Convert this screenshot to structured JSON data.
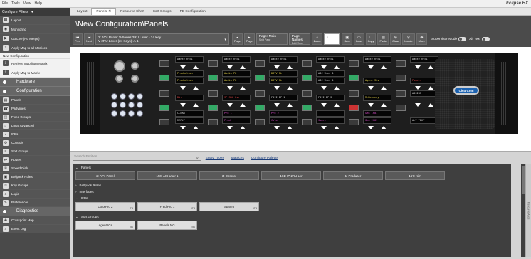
{
  "menu": {
    "items": [
      "File",
      "Tools",
      "View",
      "Help"
    ],
    "brand": "Eclipse HX"
  },
  "sidebar": {
    "header": "Configure Filters",
    "top_items": [
      {
        "label": "Layout",
        "icon": "layout-icon"
      },
      {
        "label": "Monitoring",
        "icon": "monitor-icon"
      },
      {
        "label": "Go Live (No Merge)",
        "icon": "golive-icon"
      },
      {
        "label": "Apply Map to all Matrices",
        "icon": "apply-icon"
      }
    ],
    "panel_items": [
      {
        "label": "New Configuration",
        "icon": ""
      },
      {
        "label": "Retrieve Map from Matrix",
        "icon": "retrieve-icon"
      },
      {
        "label": "Apply Map to Matrix",
        "icon": "apply-icon"
      }
    ],
    "sections": [
      {
        "label": "Hardware"
      },
      {
        "label": "Configuration"
      },
      {
        "label": "Diagnostics"
      }
    ],
    "config_items": [
      {
        "label": "Panels"
      },
      {
        "label": "Partylines"
      },
      {
        "label": "Fixed Groups"
      },
      {
        "label": "Local Advanced"
      },
      {
        "label": "IFBs"
      },
      {
        "label": "Controls"
      },
      {
        "label": "Sort Groups"
      },
      {
        "label": "Routes"
      },
      {
        "label": "Speed Dials"
      },
      {
        "label": "Bellpack Roles"
      },
      {
        "label": "Key Groups"
      },
      {
        "label": "Logic"
      },
      {
        "label": "Preferences"
      }
    ],
    "diag_items": [
      {
        "label": "Crosspoint Map"
      },
      {
        "label": "Event Log"
      }
    ]
  },
  "tabs": [
    "Layout",
    "Panels",
    "Resource Chart",
    "Sort Groups",
    "PB Configuration"
  ],
  "page": {
    "title": "\\New Configuration\\Panels",
    "toolbar": {
      "prev": "Prev",
      "next": "Next",
      "panel_line1": "2: AT's Panel: V-Series 2RU Lever - 24 Key",
      "panel_line2": "V 2RU Lever (24 Keys): A-1",
      "page_prev": "Page",
      "page_next": "Page",
      "page_select": "Page: Main",
      "page_select_sub": "Shift Page",
      "page_names": "Page Names",
      "page_names_sub": "Edit/View",
      "zoom": "Zoom",
      "save": "Save",
      "load": "Load",
      "copy": "Copy",
      "paste": "Paste",
      "clear": "Clear",
      "locate": "Locate",
      "move": "Move",
      "supervisor": "Supervisor Mode",
      "alttext": "Alt Text"
    }
  },
  "device": {
    "lcd_rows": [
      [
        "Dante ntc1",
        "Dante ntc1",
        "Dante ntc1",
        "Dante ntc1",
        "Dante ntc1",
        "Dante ntc1"
      ],
      [
        "Production",
        "Audio PL",
        "DBTV PL",
        "AIC User 1",
        "",
        ""
      ],
      [
        "Production",
        "Audio PL",
        "DBTV PL",
        "AIC User 1",
        "Agent ICs",
        "Panels"
      ],
      [
        "",
        "",
        "",
        "",
        "",
        "ASSIGN"
      ],
      [
        "Dir",
        "IP SRU Lvr",
        "FOII BP 1",
        "FOII BP 2",
        "M.Kennedy",
        ""
      ],
      [
        "CLEAR",
        "Pro 1",
        "Pro 2",
        "",
        "Gen 1H01",
        ""
      ],
      [
        "REPLY",
        "Prod",
        "Color",
        "Spare",
        "Gen 2H01",
        "ALT TEXT"
      ]
    ],
    "logo": "ClearCom"
  },
  "lower": {
    "search_placeholder": "Search Entities",
    "links": [
      "Entity Types",
      "Matrices",
      "Configure Palette"
    ],
    "groups": [
      {
        "label": "Panels",
        "expanded": true,
        "cards": [
          {
            "label": "2: AT's Panel"
          },
          {
            "label": "150: AIC User 1"
          },
          {
            "label": "3: Director"
          },
          {
            "label": "161: IP 2RU Lvr"
          },
          {
            "label": "1: Producer"
          },
          {
            "label": "167: Kim"
          }
        ]
      },
      {
        "label": "Beltpack Roles",
        "expanded": false,
        "cards": []
      },
      {
        "label": "Interfaces",
        "expanded": false,
        "cards": []
      },
      {
        "label": "IFBs",
        "expanded": true,
        "cards": [
          {
            "label": "ColorPro 2",
            "count": "IFB"
          },
          {
            "label": "Fred Pro 1",
            "count": "IFB"
          },
          {
            "label": "Spare3",
            "count": "IFB"
          }
        ]
      },
      {
        "label": "Sort Groups",
        "expanded": true,
        "cards": [
          {
            "label": "Agent ICs",
            "count": "SG"
          },
          {
            "label": "Panels NG",
            "count": "SG"
          }
        ]
      }
    ],
    "side_tab": "Resource Apps"
  }
}
